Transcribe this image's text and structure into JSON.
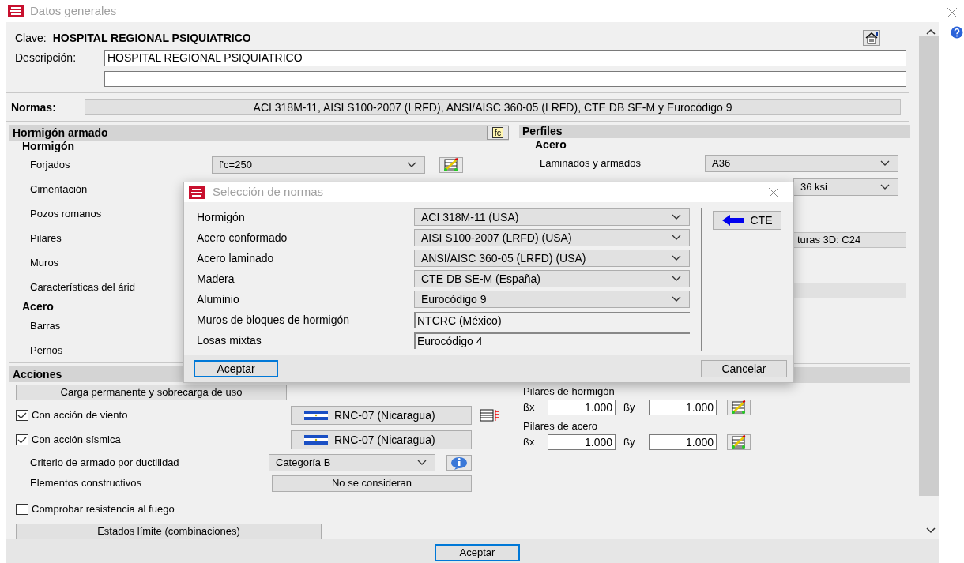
{
  "window": {
    "title": "Datos generales"
  },
  "clave": {
    "label": "Clave:",
    "value": "HOSPITAL REGIONAL PSIQUIATRICO"
  },
  "descripcion": {
    "label": "Descripción:",
    "value": "HOSPITAL REGIONAL PSIQUIATRICO"
  },
  "normas": {
    "label": "Normas:",
    "value": "ACI 318M-11, AISI S100-2007 (LRFD), ANSI/AISC 360-05 (LRFD), CTE DB SE-M y Eurocódigo 9"
  },
  "hormigon_armado": {
    "title": "Hormigón armado",
    "icon_text": "fc",
    "groups": [
      {
        "title": "Hormigón",
        "rows": [
          {
            "label": "Forjados",
            "kind": "select",
            "value": "f'c=250"
          },
          {
            "label": "Cimentación",
            "kind": "label"
          },
          {
            "label": "Pozos romanos",
            "kind": "label"
          },
          {
            "label": "Pilares",
            "kind": "label"
          },
          {
            "label": "Muros",
            "kind": "label"
          },
          {
            "label": "Características del árid",
            "kind": "label"
          }
        ]
      },
      {
        "title": "Acero",
        "rows": [
          {
            "label": "Barras",
            "kind": "label"
          },
          {
            "label": "Pernos",
            "kind": "label"
          }
        ]
      }
    ]
  },
  "perfiles": {
    "title": "Perfiles",
    "subtitle": "Acero",
    "rows": [
      {
        "label": "Laminados y armados",
        "value": "A36"
      }
    ],
    "partial_fields": [
      {
        "kind": "select",
        "value": "36 ksi"
      },
      {
        "kind": "field",
        "value": "turas 3D: C24"
      },
      {
        "kind": "field"
      }
    ]
  },
  "acciones": {
    "title": "Acciones",
    "load_button": "Carga permanente y sobrecarga de uso",
    "items": [
      {
        "kind": "check_norm",
        "label": "Con acción de viento",
        "checked": true,
        "norm": "RNC-07 (Nicaragua)",
        "has_table_icon": true
      },
      {
        "kind": "check_norm",
        "label": "Con acción sísmica",
        "checked": true,
        "norm": "RNC-07 (Nicaragua)",
        "has_table_icon": false
      },
      {
        "kind": "select",
        "label": "Criterio de armado por ductilidad",
        "value": "Categoría B"
      },
      {
        "kind": "button",
        "label": "Elementos constructivos",
        "value": "No se consideran"
      },
      {
        "kind": "check",
        "label": "Comprobar resistencia al fuego",
        "checked": false
      }
    ],
    "combinations_button": "Estados límite (combinaciones)"
  },
  "pandeo": {
    "groups": [
      {
        "title": "Pilares de hormigón",
        "bx_label": "ßx",
        "bx": "1.000",
        "by_label": "ßy",
        "by": "1.000"
      },
      {
        "title": "Pilares de acero",
        "bx_label": "ßx",
        "bx": "1.000",
        "by_label": "ßy",
        "by": "1.000"
      }
    ]
  },
  "dialog": {
    "title": "Selección de normas",
    "rows": [
      {
        "label": "Hormigón",
        "kind": "select",
        "value": "ACI 318M-11 (USA)"
      },
      {
        "label": "Acero conformado",
        "kind": "select",
        "value": "AISI S100-2007 (LRFD) (USA)"
      },
      {
        "label": "Acero laminado",
        "kind": "select",
        "value": "ANSI/AISC 360-05 (LRFD) (USA)"
      },
      {
        "label": "Madera",
        "kind": "select",
        "value": "CTE DB SE-M (España)"
      },
      {
        "label": "Aluminio",
        "kind": "select",
        "value": "Eurocódigo 9"
      },
      {
        "label": "Muros de bloques de hormigón",
        "kind": "field",
        "value": "NTCRC (México)"
      },
      {
        "label": "Losas mixtas",
        "kind": "field",
        "value": "Eurocódigo 4"
      }
    ],
    "cte_button": "CTE",
    "ok_button": "Aceptar",
    "cancel_button": "Cancelar"
  },
  "footer": {
    "ok_button": "Aceptar"
  }
}
